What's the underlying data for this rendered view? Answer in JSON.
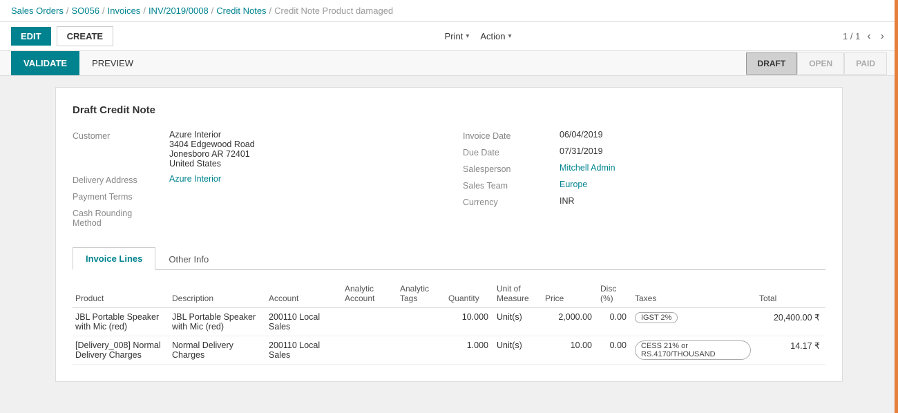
{
  "breadcrumb": {
    "items": [
      {
        "label": "Sales Orders",
        "link": true
      },
      {
        "label": "SO056",
        "link": true
      },
      {
        "label": "Invoices",
        "link": true
      },
      {
        "label": "INV/2019/0008",
        "link": true
      },
      {
        "label": "Credit Notes",
        "link": true
      },
      {
        "label": "Credit Note Product damaged",
        "link": false
      }
    ],
    "separator": "/"
  },
  "toolbar": {
    "edit_label": "EDIT",
    "create_label": "CREATE",
    "print_label": "Print",
    "action_label": "Action",
    "pagination": "1 / 1"
  },
  "status_bar": {
    "validate_label": "VALIDATE",
    "preview_label": "PREVIEW",
    "statuses": [
      {
        "label": "DRAFT",
        "active": true
      },
      {
        "label": "OPEN",
        "active": false
      },
      {
        "label": "PAID",
        "active": false
      }
    ]
  },
  "form": {
    "title": "Draft Credit Note",
    "left": {
      "customer_label": "Customer",
      "customer_name": "Azure Interior",
      "customer_addr1": "3404 Edgewood Road",
      "customer_addr2": "Jonesboro AR 72401",
      "customer_country": "United States",
      "delivery_label": "Delivery Address",
      "delivery_value": "Azure Interior",
      "payment_terms_label": "Payment Terms",
      "cash_rounding_label": "Cash Rounding",
      "method_label": "Method"
    },
    "right": {
      "invoice_date_label": "Invoice Date",
      "invoice_date_value": "06/04/2019",
      "due_date_label": "Due Date",
      "due_date_value": "07/31/2019",
      "salesperson_label": "Salesperson",
      "salesperson_value": "Mitchell Admin",
      "sales_team_label": "Sales Team",
      "sales_team_value": "Europe",
      "currency_label": "Currency",
      "currency_value": "INR"
    }
  },
  "tabs": [
    {
      "label": "Invoice Lines",
      "active": true
    },
    {
      "label": "Other Info",
      "active": false
    }
  ],
  "table": {
    "headers": [
      {
        "label": "Product",
        "class": "col-product"
      },
      {
        "label": "Description",
        "class": "col-desc"
      },
      {
        "label": "Account",
        "class": "col-account"
      },
      {
        "label": "Analytic Account",
        "class": "col-analytic-acc"
      },
      {
        "label": "Analytic Tags",
        "class": "col-analytic-tags"
      },
      {
        "label": "Quantity",
        "class": "col-qty right"
      },
      {
        "label": "Unit of Measure",
        "class": "col-uom"
      },
      {
        "label": "Price",
        "class": "col-price right"
      },
      {
        "label": "Disc (%)",
        "class": "col-disc right"
      },
      {
        "label": "Taxes",
        "class": "col-taxes"
      },
      {
        "label": "Total",
        "class": "col-total right"
      }
    ],
    "rows": [
      {
        "product": "JBL Portable Speaker with Mic (red)",
        "description": "JBL Portable Speaker with Mic (red)",
        "account": "200110 Local Sales",
        "analytic_account": "",
        "analytic_tags": "",
        "quantity": "10.000",
        "uom": "Unit(s)",
        "price": "2,000.00",
        "disc": "0.00",
        "taxes": "IGST 2%",
        "total": "20,400.00 ₹"
      },
      {
        "product": "[Delivery_008] Normal Delivery Charges",
        "description": "Normal Delivery Charges",
        "account": "200110 Local Sales",
        "analytic_account": "",
        "analytic_tags": "",
        "quantity": "1.000",
        "uom": "Unit(s)",
        "price": "10.00",
        "disc": "0.00",
        "taxes": "CESS 21% or RS.4170/THOUSAND",
        "total": "14.17 ₹"
      }
    ]
  }
}
